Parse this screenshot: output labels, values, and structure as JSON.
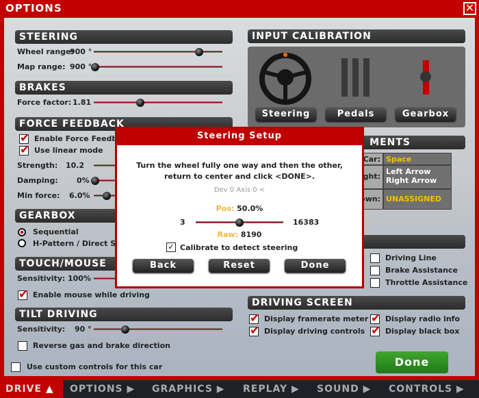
{
  "window": {
    "title": "OPTIONS",
    "close": "✕"
  },
  "steering": {
    "title": "STEERING",
    "wheel_range_label": "Wheel range:",
    "wheel_range_value": "900 °",
    "wheel_range_level": 0.82,
    "map_range_label": "Map range:",
    "map_range_value": "900 °",
    "map_range_level": 0.0
  },
  "brakes": {
    "title": "BRAKES",
    "force_factor_label": "Force factor:",
    "force_factor_value": "1.81",
    "force_factor_level": 0.36
  },
  "force_feedback": {
    "title": "FORCE FEEDBACK",
    "enable_label": "Enable Force Feedback",
    "enable_checked": true,
    "linear_label": "Use linear mode",
    "linear_checked": true,
    "strength_label": "Strength:",
    "strength_value": "10.2",
    "damping_label": "Damping:",
    "damping_value": "0%",
    "min_force_label": "Min force:",
    "min_force_value": "6.0%"
  },
  "gearbox": {
    "title": "GEARBOX",
    "options": [
      "Sequential",
      "H-Pattern / Direct Select"
    ],
    "selected": 0
  },
  "touch": {
    "title": "TOUCH/MOUSE",
    "sensitivity_label": "Sensitivity:",
    "sensitivity_value": "100%",
    "mouse_label": "Enable mouse while driving",
    "mouse_checked": true
  },
  "tilt": {
    "title": "TILT DRIVING",
    "sensitivity_label": "Sensitivity:",
    "sensitivity_value": "90 °",
    "sensitivity_level": 0.25,
    "reverse_label": "Reverse gas and brake direction",
    "reverse_checked": false
  },
  "custom_controls": {
    "label": "Use custom controls for this car",
    "checked": false
  },
  "input_calibration": {
    "title": "INPUT CALIBRATION",
    "buttons": [
      "Steering",
      "Pedals",
      "Gearbox"
    ]
  },
  "assignments": {
    "title": "MENTS",
    "rows": [
      {
        "label": "Car:",
        "value": "Space"
      },
      {
        "label": "ght:",
        "value": "Left Arrow",
        "value2": "Right Arrow"
      },
      {
        "label": "own:",
        "value": "UNASSIGNED"
      }
    ]
  },
  "assists": {
    "items": [
      {
        "label": "Driving Line",
        "checked": false
      },
      {
        "label": "Brake Assistance",
        "checked": false
      },
      {
        "label": "Throttle Assistance",
        "checked": false
      }
    ]
  },
  "driving_screen": {
    "title": "DRIVING SCREEN",
    "items": [
      {
        "label": "Display framerate meter",
        "checked": true
      },
      {
        "label": "Display driving controls",
        "checked": true
      },
      {
        "label": "Display radio info",
        "checked": true
      },
      {
        "label": "Display black box",
        "checked": true
      }
    ]
  },
  "done_label": "Done",
  "dialog": {
    "title": "Steering Setup",
    "instruction1": "Turn the wheel fully one way and then the other,",
    "instruction2": "return to center and click <DONE>.",
    "device": "Dev 0 Axis 0 <",
    "pos_label": "Pos:",
    "pos_value": "50.0%",
    "min": "3",
    "max": "16383",
    "raw_label": "Raw:",
    "raw_value": "8190",
    "calibrate_label": "Calibrate to detect steering",
    "calibrate_checked": true,
    "back": "Back",
    "reset": "Reset",
    "done": "Done"
  },
  "nav": {
    "items": [
      "DRIVE",
      "OPTIONS",
      "GRAPHICS",
      "REPLAY",
      "SOUND",
      "CONTROLS"
    ],
    "active": 0
  },
  "colors": {
    "accent": "#c30000",
    "done": "#2e8b1e",
    "highlight": "#f4c200"
  }
}
